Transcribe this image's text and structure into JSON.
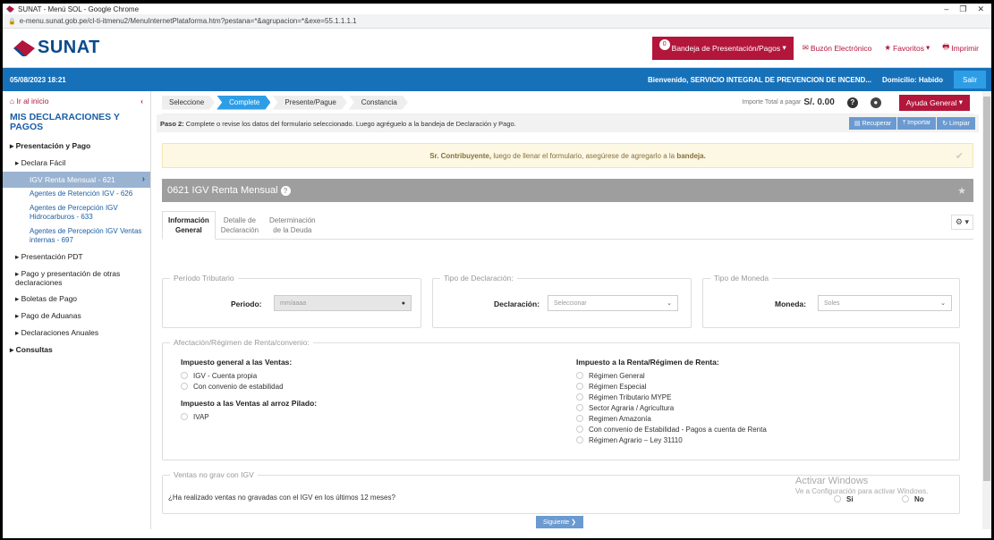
{
  "window": {
    "title": "SUNAT - Menú SOL - Google Chrome",
    "url": "e-menu.sunat.gob.pe/cl-ti-itmenu2/MenuInternetPlataforma.htm?pestana=*&agrupacion=*&exe=55.1.1.1.1"
  },
  "header": {
    "brand": "SUNAT",
    "badge": "0",
    "bandeja": "Bandeja de Presentación/Pagos",
    "buzon": "Buzón Electrónico",
    "favoritos": "Favoritos",
    "imprimir": "Imprimir"
  },
  "bluebar": {
    "datetime": "05/08/2023 18:21",
    "welcome": "Bienvenido, SERVICIO INTEGRAL DE PREVENCION DE INCEND...",
    "domicilio": "Domicilio: Habido",
    "salir": "Salir"
  },
  "sidebar": {
    "ir": "Ir al inicio",
    "title": "MIS DECLARACIONES Y PAGOS",
    "items": [
      "Presentación y Pago",
      "Declara Fácil",
      "IGV Renta Mensual - 621",
      "Agentes de Retención IGV - 626",
      "Agentes de Percepción IGV Hidrocarburos - 633",
      "Agentes de Percepción IGV Ventas internas - 697",
      "Presentación PDT",
      "Pago y presentación de otras declaraciones",
      "Boletas de Pago",
      "Pago de Aduanas",
      "Declaraciones Anuales",
      "Consultas"
    ]
  },
  "steps": [
    "Seleccione",
    "Complete",
    "Presente/Pague",
    "Constancia"
  ],
  "importe": {
    "label": "Importe Total a pagar",
    "value": "S/. 0.00"
  },
  "ayuda": "Ayuda General",
  "paso": {
    "bold": "Paso 2:",
    "text": " Complete o revise los datos del formulario seleccionado. Luego agréguelo a la bandeja de Declaración y Pago.",
    "recuperar": "Recuperar",
    "importar": "Importar",
    "limpiar": "Limpiar"
  },
  "notice": {
    "bold": "Sr. Contribuyente,",
    "text": " luego de llenar el formulario, asegúrese de agregarlo a la ",
    "bold2": "bandeja."
  },
  "form": {
    "title": "0621 IGV Renta Mensual",
    "tabs": [
      [
        "Información",
        "General"
      ],
      [
        "Detalle de",
        "Declaración"
      ],
      [
        "Determinación",
        "de la Deuda"
      ]
    ],
    "periodo": {
      "legend": "Período Tributario",
      "label": "Periodo:",
      "placeholder": "mm/aaaa"
    },
    "tipo_decl": {
      "legend": "Tipo de Declaración:",
      "label": "Declaración:",
      "value": "Seleccionar"
    },
    "moneda": {
      "legend": "Tipo de Moneda",
      "label": "Moneda:",
      "value": "Soles"
    },
    "afectacion": {
      "legend": "Afectación/Régimen de Renta/convenio:",
      "ventas_title": "Impuesto general a las Ventas:",
      "ventas": [
        "IGV - Cuenta propia",
        "Con convenio de estabilidad"
      ],
      "arroz_title": "Impuesto a las Ventas al arroz Pilado:",
      "arroz": [
        "IVAP"
      ],
      "renta_title": "Impuesto a la Renta/Régimen de Renta:",
      "renta": [
        "Régimen General",
        "Régimen Especial",
        "Régimen Tributario MYPE",
        "Sector Agraria / Agricultura",
        "Regimen Amazonía",
        "Con convenio de Estabilidad - Pagos a cuenta de Renta",
        "Régimen Agrario – Ley 31110"
      ]
    },
    "ventas_no_grav": {
      "legend": "Ventas no grav con IGV",
      "question": "¿Ha realizado ventas no gravadas con el IGV en los últimos 12 meses?",
      "si": "Si",
      "no": "No"
    },
    "siguiente": "Siguiente"
  },
  "watermark": {
    "title": "Activar Windows",
    "sub": "Ve a Configuración para activar Windows."
  }
}
